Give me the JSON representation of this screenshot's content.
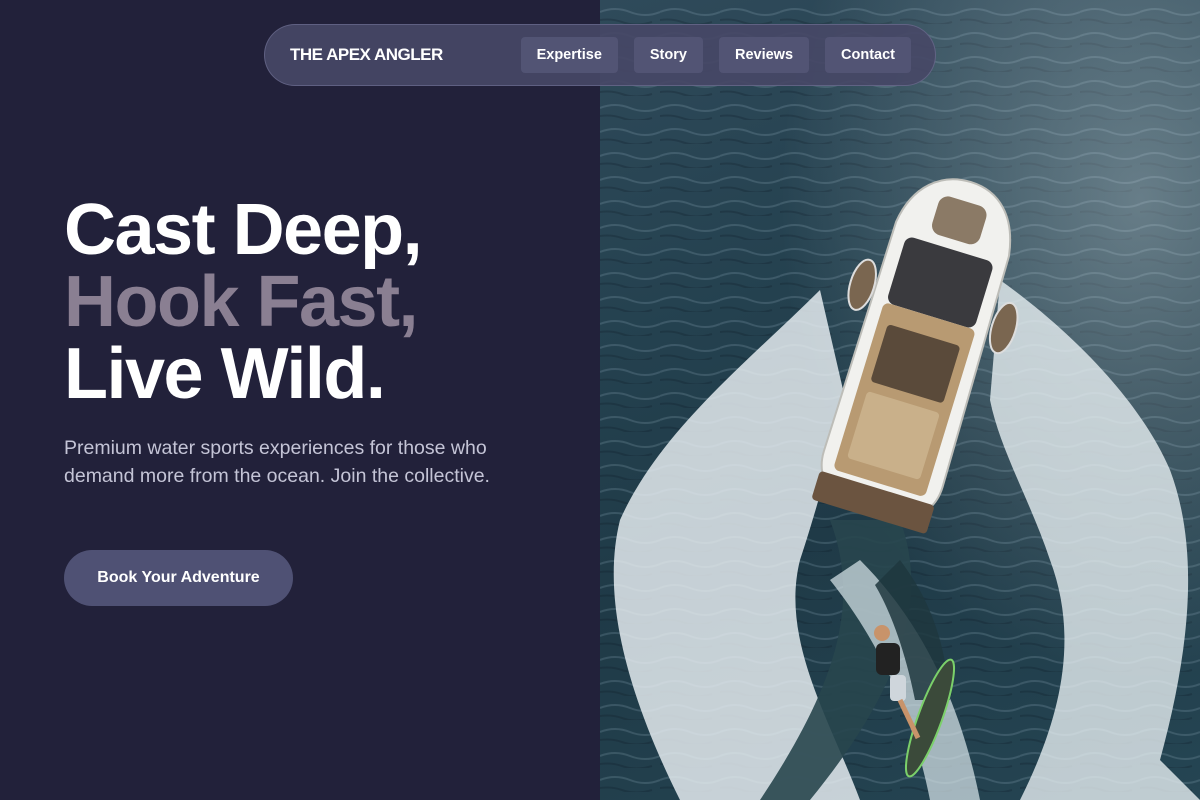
{
  "nav": {
    "brand": "THE APEX ANGLER",
    "links": [
      {
        "label": "Expertise"
      },
      {
        "label": "Story"
      },
      {
        "label": "Reviews"
      },
      {
        "label": "Contact"
      }
    ]
  },
  "hero": {
    "title_line_1": "Cast Deep,",
    "title_line_2": "Hook Fast,",
    "title_line_3": "Live Wild.",
    "subtitle": "Premium water sports experiences for those who demand more from the ocean. Join the collective.",
    "cta_label": "Book Your Adventure"
  },
  "colors": {
    "background": "#22213a",
    "accent_muted": "#8a7f92",
    "button": "#4f5174",
    "nav_bg": "#464866"
  },
  "image": {
    "subject": "boat-wakeboarder-photo"
  }
}
